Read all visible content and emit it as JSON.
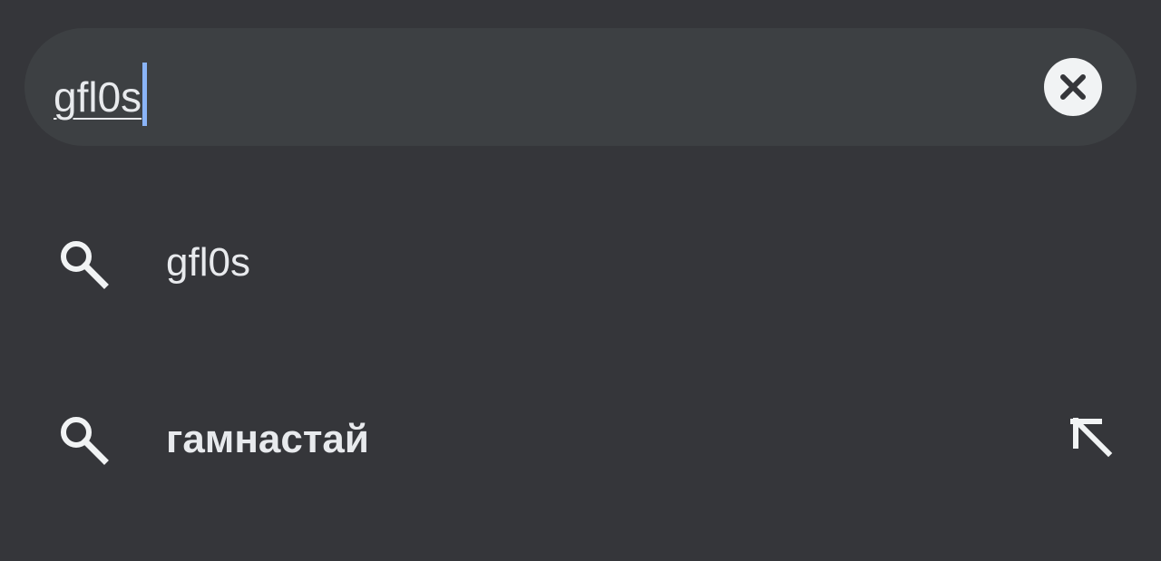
{
  "search": {
    "query": "gfl0s",
    "clear_icon": "close-circle-icon"
  },
  "suggestions": [
    {
      "label": "gfl0s",
      "icon": "search-icon",
      "bold": false
    },
    {
      "label": "гамнастай",
      "icon": "search-icon",
      "bold": true,
      "trailing_icon": "arrow-up-left-icon"
    }
  ],
  "colors": {
    "background": "#35363a",
    "search_bar": "#3d4043",
    "text": "#e8eaed",
    "caret": "#8ab4f8"
  }
}
